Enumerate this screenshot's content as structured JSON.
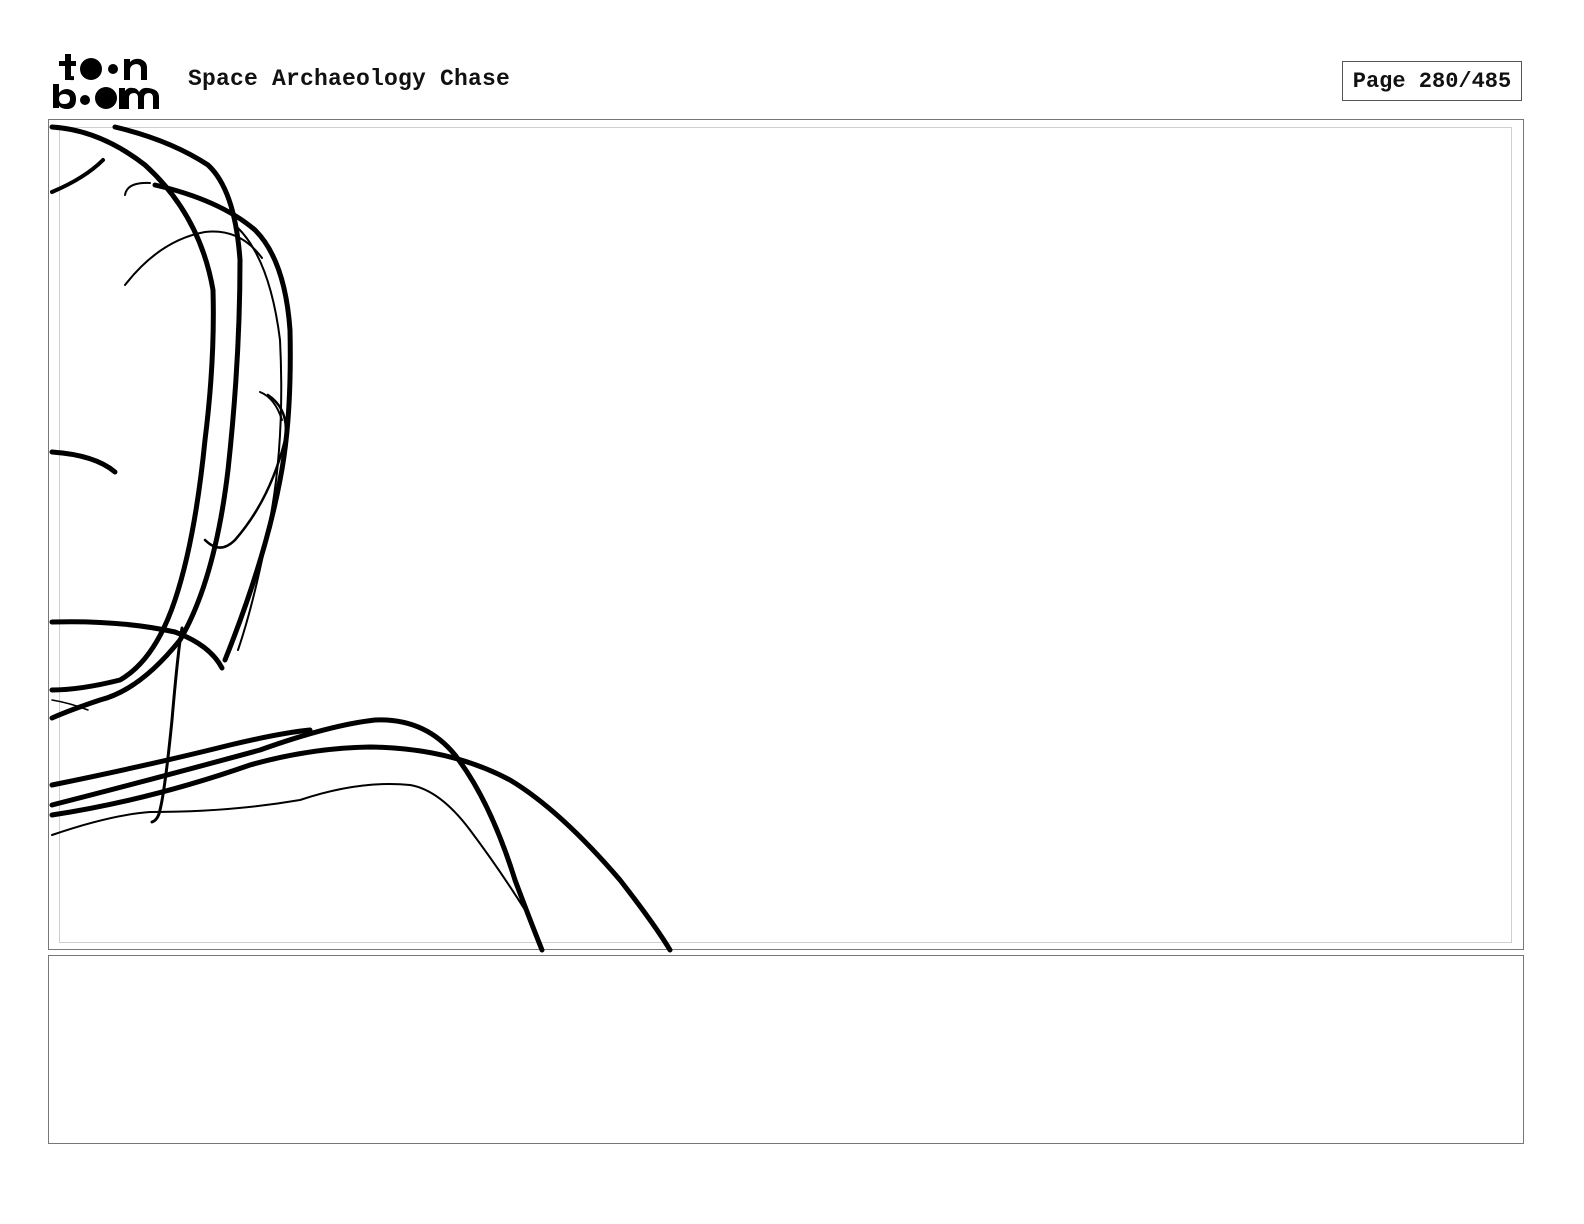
{
  "header": {
    "logo_text": "toon boom",
    "project_title": "Space Archaeology Chase",
    "page_label": "Page 280/485"
  },
  "panel": {
    "caption": ""
  },
  "colors": {
    "ink": "#000000",
    "frame": "#777777",
    "background": "#ffffff"
  }
}
